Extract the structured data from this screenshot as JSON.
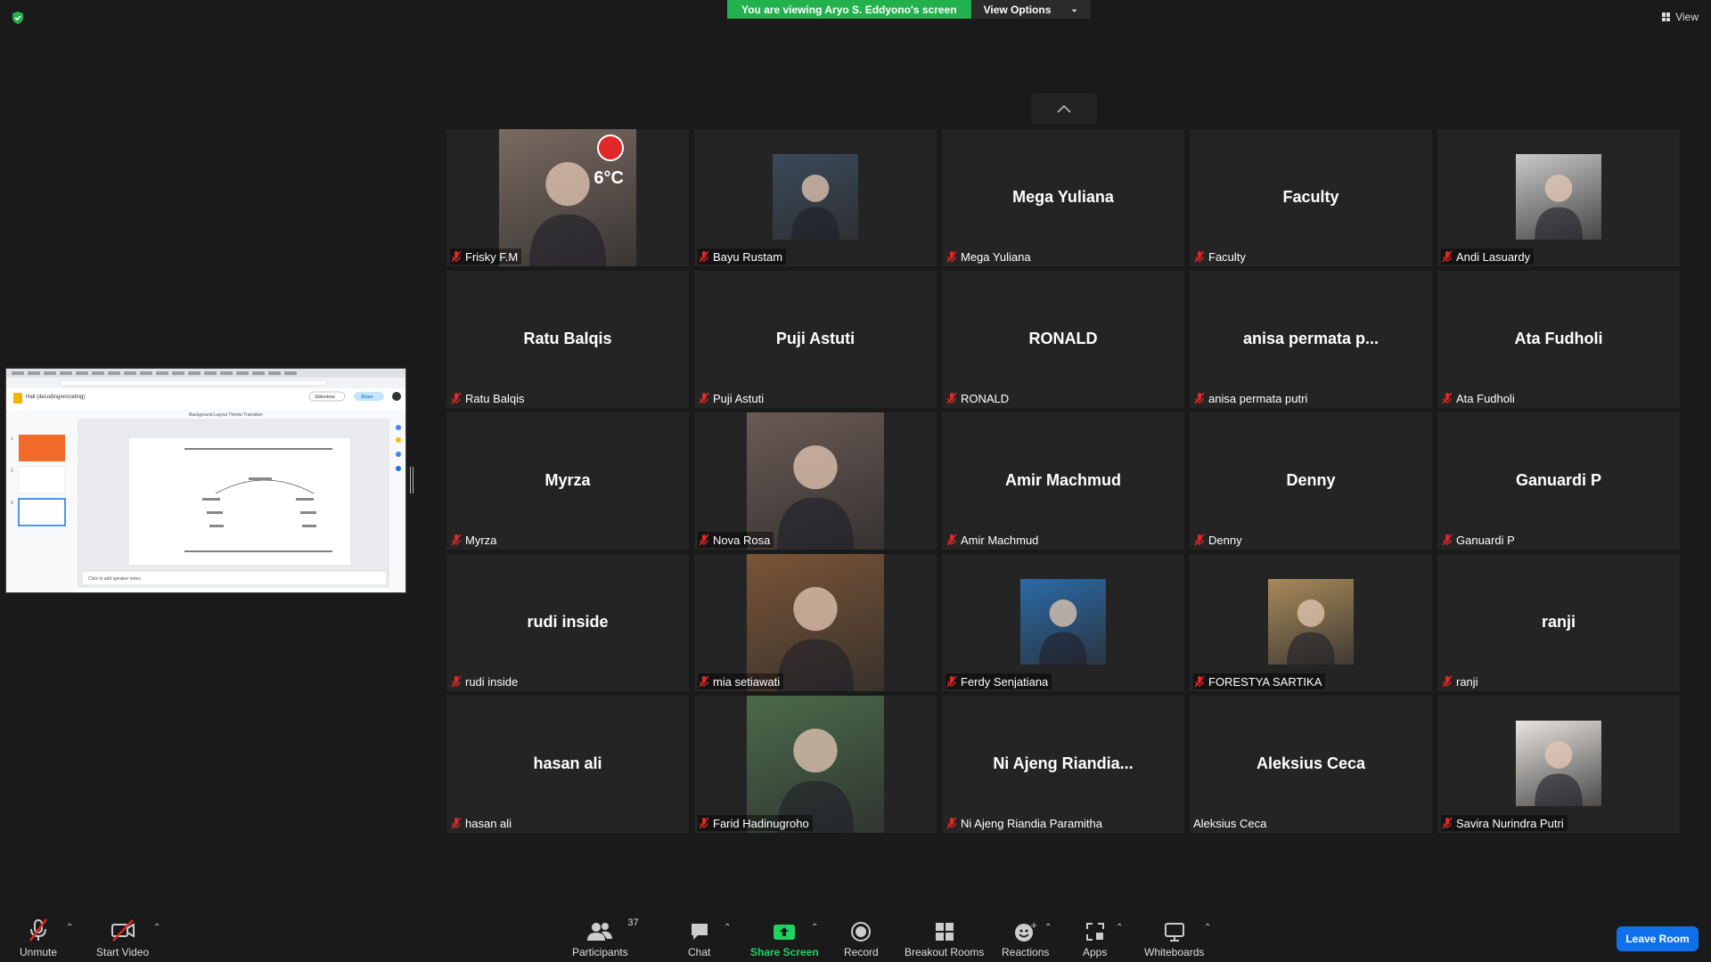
{
  "banner": {
    "viewing_text": "You are viewing Aryo S. Eddyono's screen",
    "view_options_label": "View Options"
  },
  "top_right": {
    "view_label": "View"
  },
  "participants_grid": [
    {
      "big_name": "",
      "label": "Frisky F.M",
      "video": "street-photo",
      "muted": true
    },
    {
      "big_name": "",
      "label": "Bayu Rustam",
      "video": "profile-photo",
      "muted": true
    },
    {
      "big_name": "Mega Yuliana",
      "label": "Mega Yuliana",
      "video": "",
      "muted": true
    },
    {
      "big_name": "Faculty",
      "label": "Faculty",
      "video": "",
      "muted": true
    },
    {
      "big_name": "",
      "label": "Andi Lasuardy",
      "video": "profile-photo",
      "muted": true
    },
    {
      "big_name": "Ratu Balqis",
      "label": "Ratu Balqis",
      "video": "",
      "muted": true
    },
    {
      "big_name": "Puji Astuti",
      "label": "Puji Astuti",
      "video": "",
      "muted": true
    },
    {
      "big_name": "RONALD",
      "label": "RONALD",
      "video": "",
      "muted": true
    },
    {
      "big_name": "anisa permata p...",
      "label": "anisa permata putri",
      "video": "",
      "muted": true
    },
    {
      "big_name": "Ata Fudholi",
      "label": "Ata Fudholi",
      "video": "",
      "muted": true
    },
    {
      "big_name": "Myrza",
      "label": "Myrza",
      "video": "",
      "muted": true
    },
    {
      "big_name": "",
      "label": "Nova Rosa",
      "video": "profile-photo",
      "muted": true
    },
    {
      "big_name": "Amir Machmud",
      "label": "Amir Machmud",
      "video": "",
      "muted": true
    },
    {
      "big_name": "Denny",
      "label": "Denny",
      "video": "",
      "muted": true
    },
    {
      "big_name": "Ganuardi P",
      "label": "Ganuardi P",
      "video": "",
      "muted": true
    },
    {
      "big_name": "rudi inside",
      "label": "rudi inside",
      "video": "",
      "muted": true
    },
    {
      "big_name": "",
      "label": "mia setiawati",
      "video": "profile-photo",
      "muted": true
    },
    {
      "big_name": "",
      "label": "Ferdy Senjatiana",
      "video": "profile-photo",
      "muted": true
    },
    {
      "big_name": "",
      "label": "FORESTYA SARTIKA",
      "video": "profile-photo",
      "muted": true
    },
    {
      "big_name": "ranji",
      "label": "ranji",
      "video": "",
      "muted": true
    },
    {
      "big_name": "hasan ali",
      "label": "hasan ali",
      "video": "",
      "muted": true
    },
    {
      "big_name": "",
      "label": "Farid Hadinugroho",
      "video": "profile-photo",
      "muted": true
    },
    {
      "big_name": "Ni  Ajeng  Riandia...",
      "label": "Ni Ajeng Riandia Paramitha",
      "video": "",
      "muted": true
    },
    {
      "big_name": "Aleksius Ceca",
      "label": "Aleksius Ceca",
      "video": "",
      "muted": false
    },
    {
      "big_name": "",
      "label": "Savira Nurindra Putri",
      "video": "profile-photo",
      "muted": true
    }
  ],
  "frisky_overlay": {
    "temperature": "6°C"
  },
  "shared_screen": {
    "doc_title": "Hall (decoding/encoding)",
    "speaker_notes": "Click to add speaker notes",
    "toolbar_items": [
      "Background",
      "Layout",
      "Theme",
      "Transition"
    ],
    "slideshow_label": "Slideshow",
    "share_label": "Share"
  },
  "toolbar": {
    "unmute": "Unmute",
    "start_video": "Start Video",
    "participants": "Participants",
    "participants_count": "37",
    "chat": "Chat",
    "share_screen": "Share Screen",
    "record": "Record",
    "breakout_rooms": "Breakout Rooms",
    "reactions": "Reactions",
    "apps": "Apps",
    "whiteboards": "Whiteboards",
    "leave_room": "Leave Room"
  },
  "colors": {
    "banner_green": "#23b14d",
    "share_green": "#23d160",
    "leave_blue": "#0e71eb",
    "mic_red": "#e02828",
    "tile_bg": "#242424"
  }
}
